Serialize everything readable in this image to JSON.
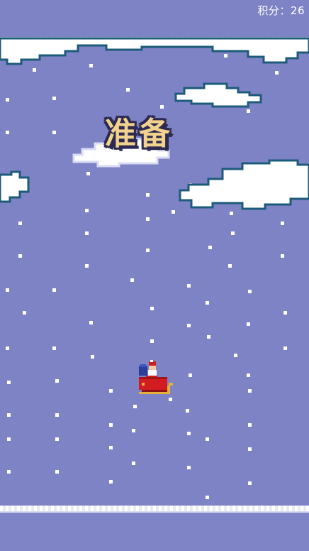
{
  "hud": {
    "score_label": "积分：",
    "score_value": "26"
  },
  "overlay": {
    "ready_text": "准备"
  },
  "colors": {
    "sky": "#7e83c5",
    "cloud_fill": "#ffffff",
    "cloud_outline": "#1d5b7a",
    "snow": "#ffffff",
    "ready_text": "#f2d28c",
    "ready_outline": "#2d2a52"
  },
  "sprites": {
    "player": "santa-sleigh",
    "obstacles": "pixel-clouds"
  }
}
